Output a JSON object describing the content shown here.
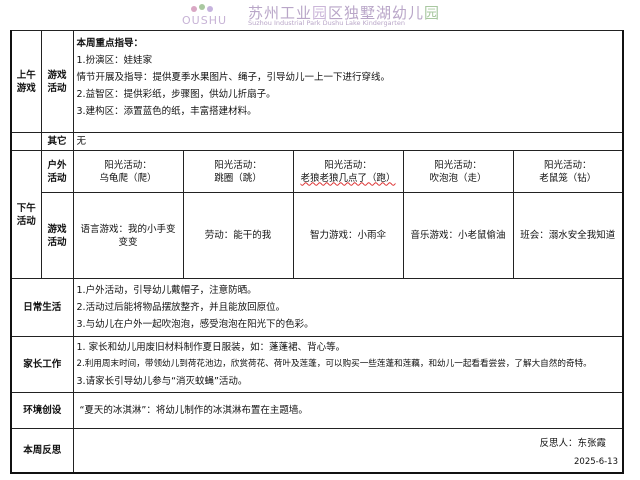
{
  "header": {
    "logo_text": "OUSHU",
    "title_part1": "苏州工业",
    "title_part2": "园",
    "title_part3": "区独墅湖幼儿",
    "title_part4": "园",
    "subtitle": "Suzhou Industrial Park Dushu Lake Kindergarten"
  },
  "morning": {
    "label": "上午游戏",
    "sub_label": "游戏活动",
    "focus_title": "本周重点指导：",
    "lines": [
      "1.扮演区：娃娃家",
      "情节开展及指导：提供夏季水果图片、绳子，引导幼儿一上一下进行穿线。",
      "2.益智区：提供彩纸，步骤图，供幼儿折扇子。",
      "3.建构区：添置蓝色的纸，丰富搭建材料。"
    ]
  },
  "other": {
    "label": "其它",
    "value": "无"
  },
  "afternoon": {
    "label": "下午活动",
    "outdoor_label": "户外活动",
    "outdoor": [
      {
        "line1": "阳光活动：",
        "line2": "乌龟爬（爬）"
      },
      {
        "line1": "阳光活动：",
        "line2": "跳圈（跳）"
      },
      {
        "line1": "阳光活动：",
        "line2": "老狼老狼几点了（跑）"
      },
      {
        "line1": "阳光活动：",
        "line2": "吹泡泡（走）"
      },
      {
        "line1": "阳光活动：",
        "line2": "老鼠笼（钻）"
      }
    ],
    "game_label": "游戏活动",
    "games": [
      "语言游戏：我的小手变变变",
      "劳动：能干的我",
      "智力游戏：小雨伞",
      "音乐游戏：小老鼠偷油",
      "班会：溺水安全我知道"
    ]
  },
  "daily": {
    "label": "日常生活",
    "lines": [
      "1.户外活动，引导幼儿戴帽子，注意防晒。",
      "2.活动过后能将物品摆放整齐，并且能放回原位。",
      "3.与幼儿在户外一起吹泡泡，感受泡泡在阳光下的色彩。"
    ]
  },
  "parents": {
    "label": "家长工作",
    "lines": [
      "1. 家长和幼儿用废旧材料制作夏日服装，如：蓬蓬裙、背心等。",
      "2.利用周末时间，带领幼儿到荷花池边，欣赏荷花、荷叶及莲蓬，可以购买一些莲蓬和莲藕，和幼儿一起看看尝尝，了解大自然的奇特。",
      "3.请家长引导幼儿参与“消灭蚊蝇”活动。"
    ]
  },
  "environment": {
    "label": "环境创设",
    "value": "“夏天的冰淇淋”：将幼儿制作的冰淇淋布置在主题墙。"
  },
  "reflection": {
    "label": "本周反思",
    "signer": "反思人：东张霞",
    "date": "2025-6-13"
  }
}
